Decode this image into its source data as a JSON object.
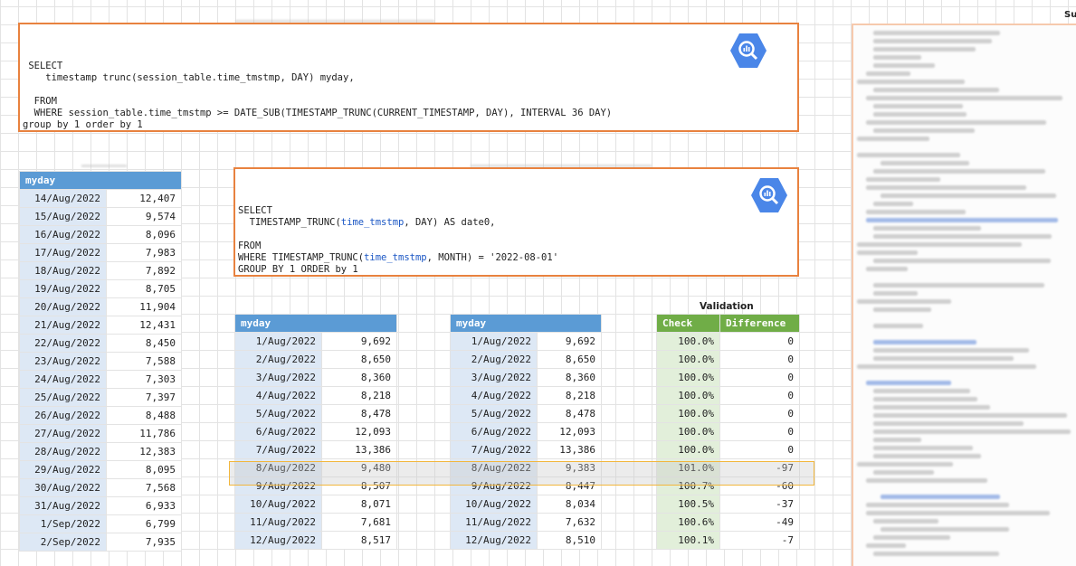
{
  "top_right_label": "Su",
  "query1": {
    "lines": [
      "",
      "",
      " SELECT",
      "    timestamp trunc(session_table.time_tmstmp, DAY) myday,",
      "",
      "  FROM",
      "  WHERE session_table.time_tmstmp >= DATE_SUB(TIMESTAMP_TRUNC(CURRENT_TIMESTAMP, DAY), INTERVAL 36 DAY)",
      "group by 1 order by 1"
    ]
  },
  "query2": {
    "line1": "SELECT",
    "line2_pre": "  TIMESTAMP_TRUNC(",
    "line2_kw": "time_tmstmp",
    "line2_post": ", DAY) AS date0,",
    "line3": "FROM",
    "line4_pre": "WHERE TIMESTAMP_TRUNC(",
    "line4_kw": "time_tmstmp",
    "line4_post": ", MONTH) = '2022-08-01'",
    "line5": "GROUP BY 1 ORDER by 1"
  },
  "icons": {
    "bq1": "bigquery-icon",
    "bq2": "bigquery-icon"
  },
  "colors": {
    "orange_border": "#e8823f",
    "header_blue": "#5b9bd5",
    "header_green": "#70ad47",
    "highlight": "#f2b63c"
  },
  "table_left": {
    "header": "myday",
    "rows": [
      [
        "14/Aug/2022",
        "12,407"
      ],
      [
        "15/Aug/2022",
        "9,574"
      ],
      [
        "16/Aug/2022",
        "8,096"
      ],
      [
        "17/Aug/2022",
        "7,983"
      ],
      [
        "18/Aug/2022",
        "7,892"
      ],
      [
        "19/Aug/2022",
        "8,705"
      ],
      [
        "20/Aug/2022",
        "11,904"
      ],
      [
        "21/Aug/2022",
        "12,431"
      ],
      [
        "22/Aug/2022",
        "8,450"
      ],
      [
        "23/Aug/2022",
        "7,588"
      ],
      [
        "24/Aug/2022",
        "7,303"
      ],
      [
        "25/Aug/2022",
        "7,397"
      ],
      [
        "26/Aug/2022",
        "8,488"
      ],
      [
        "27/Aug/2022",
        "11,786"
      ],
      [
        "28/Aug/2022",
        "12,383"
      ],
      [
        "29/Aug/2022",
        "8,095"
      ],
      [
        "30/Aug/2022",
        "7,568"
      ],
      [
        "31/Aug/2022",
        "6,933"
      ],
      [
        "1/Sep/2022",
        "6,799"
      ],
      [
        "2/Sep/2022",
        "7,935"
      ]
    ]
  },
  "table_mid": {
    "header": "myday",
    "rows": [
      [
        "1/Aug/2022",
        "9,692"
      ],
      [
        "2/Aug/2022",
        "8,650"
      ],
      [
        "3/Aug/2022",
        "8,360"
      ],
      [
        "4/Aug/2022",
        "8,218"
      ],
      [
        "5/Aug/2022",
        "8,478"
      ],
      [
        "6/Aug/2022",
        "12,093"
      ],
      [
        "7/Aug/2022",
        "13,386"
      ],
      [
        "8/Aug/2022",
        "9,480"
      ],
      [
        "9/Aug/2022",
        "8,507"
      ],
      [
        "10/Aug/2022",
        "8,071"
      ],
      [
        "11/Aug/2022",
        "7,681"
      ],
      [
        "12/Aug/2022",
        "8,517"
      ]
    ]
  },
  "table_right": {
    "header": "myday",
    "rows": [
      [
        "1/Aug/2022",
        "9,692"
      ],
      [
        "2/Aug/2022",
        "8,650"
      ],
      [
        "3/Aug/2022",
        "8,360"
      ],
      [
        "4/Aug/2022",
        "8,218"
      ],
      [
        "5/Aug/2022",
        "8,478"
      ],
      [
        "6/Aug/2022",
        "12,093"
      ],
      [
        "7/Aug/2022",
        "13,386"
      ],
      [
        "8/Aug/2022",
        "9,383"
      ],
      [
        "9/Aug/2022",
        "8,447"
      ],
      [
        "10/Aug/2022",
        "8,034"
      ],
      [
        "11/Aug/2022",
        "7,632"
      ],
      [
        "12/Aug/2022",
        "8,510"
      ]
    ]
  },
  "validation": {
    "title": "Validation",
    "col_check": "Check",
    "col_diff": "Difference",
    "rows": [
      [
        "100.0%",
        "0"
      ],
      [
        "100.0%",
        "0"
      ],
      [
        "100.0%",
        "0"
      ],
      [
        "100.0%",
        "0"
      ],
      [
        "100.0%",
        "0"
      ],
      [
        "100.0%",
        "0"
      ],
      [
        "100.0%",
        "0"
      ],
      [
        "101.0%",
        "-97"
      ],
      [
        "100.7%",
        "-60"
      ],
      [
        "100.5%",
        "-37"
      ],
      [
        "100.6%",
        "-49"
      ],
      [
        "100.1%",
        "-7"
      ]
    ]
  }
}
